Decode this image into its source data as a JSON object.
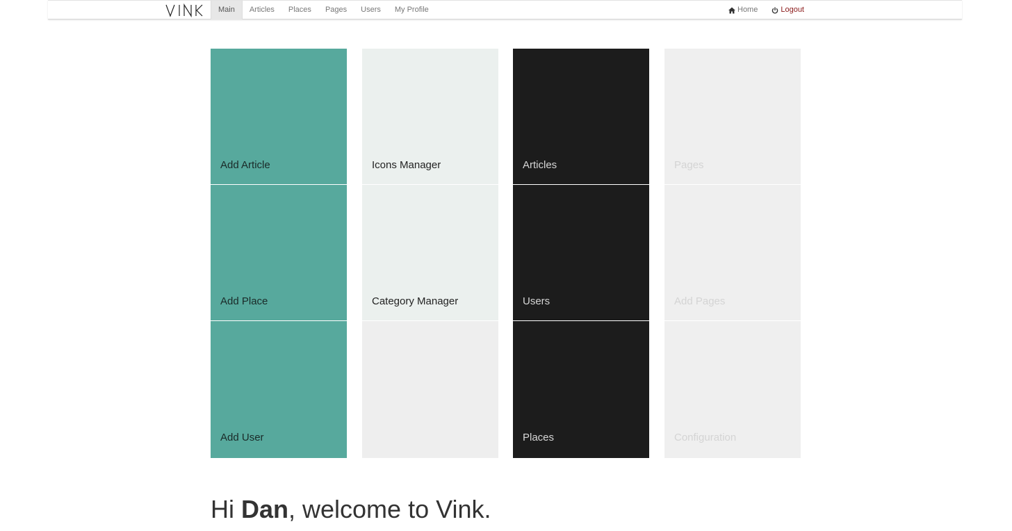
{
  "brand": {
    "name": "VINK"
  },
  "nav": {
    "tabs": [
      {
        "label": "Main",
        "active": true
      },
      {
        "label": "Articles",
        "active": false
      },
      {
        "label": "Places",
        "active": false
      },
      {
        "label": "Pages",
        "active": false
      },
      {
        "label": "Users",
        "active": false
      },
      {
        "label": "My Profile",
        "active": false
      }
    ],
    "right": {
      "home": {
        "label": "Home",
        "icon": "home-icon"
      },
      "logout": {
        "label": "Logout",
        "icon": "power-icon"
      }
    }
  },
  "tiles": {
    "teal": [
      "Add Article",
      "Add Place",
      "Add User"
    ],
    "light": [
      "Icons Manager",
      "Category Manager",
      ""
    ],
    "dark": [
      "Articles",
      "Users",
      "Places"
    ],
    "gray": [
      "Pages",
      "Add Pages",
      "Configuration"
    ]
  },
  "welcome": {
    "greeting": "Hi ",
    "name": "Dan",
    "rest": ", welcome to Vink."
  },
  "colors": {
    "teal": "#57a99d",
    "light": "#ebf0ee",
    "dark": "#1c1c1c",
    "gray": "#efefef",
    "logout": "#8b1a1a"
  }
}
